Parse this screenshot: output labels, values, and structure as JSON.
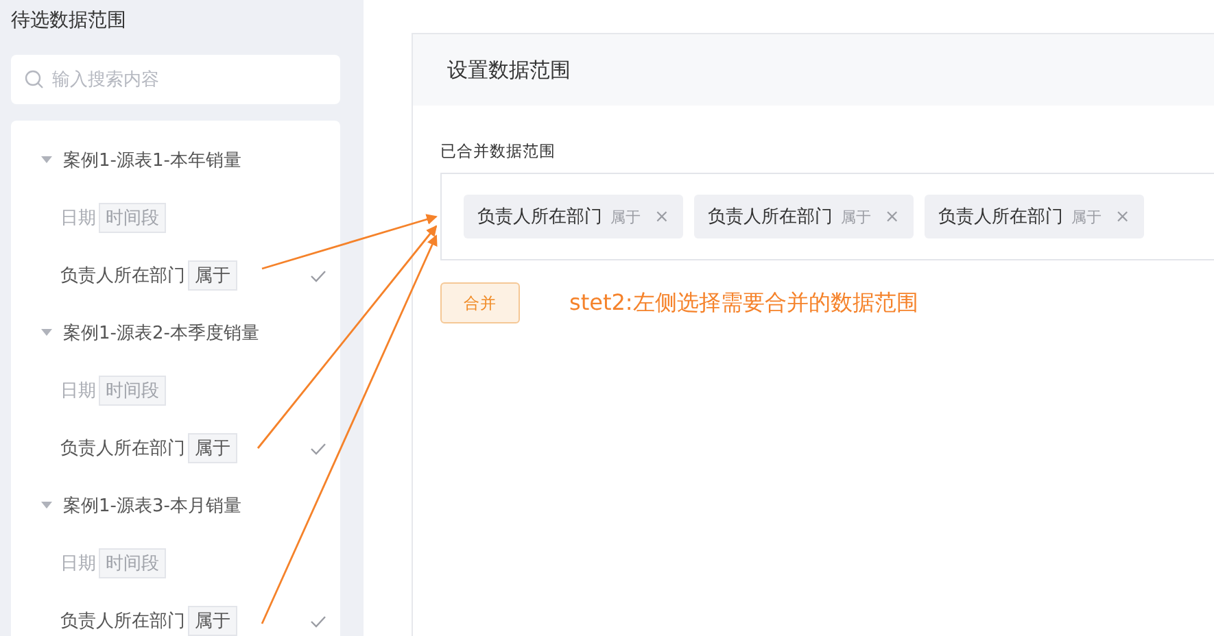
{
  "sidebar": {
    "title": "待选数据范围",
    "search": {
      "placeholder": "输入搜索内容"
    },
    "groups": [
      {
        "label": "案例1-源表1-本年销量",
        "expanded": true,
        "children": [
          {
            "label": "日期",
            "tag": "时间段",
            "disabled": true,
            "checked": false
          },
          {
            "label": "负责人所在部门",
            "tag": "属于",
            "disabled": false,
            "checked": true
          }
        ]
      },
      {
        "label": "案例1-源表2-本季度销量",
        "expanded": true,
        "children": [
          {
            "label": "日期",
            "tag": "时间段",
            "disabled": true,
            "checked": false
          },
          {
            "label": "负责人所在部门",
            "tag": "属于",
            "disabled": false,
            "checked": true
          }
        ]
      },
      {
        "label": "案例1-源表3-本月销量",
        "expanded": true,
        "children": [
          {
            "label": "日期",
            "tag": "时间段",
            "disabled": true,
            "checked": false
          },
          {
            "label": "负责人所在部门",
            "tag": "属于",
            "disabled": false,
            "checked": true
          }
        ]
      }
    ]
  },
  "dialog": {
    "title": "设置数据范围",
    "merged_label": "已合并数据范围",
    "tags": [
      {
        "label": "负责人所在部门",
        "operator": "属于",
        "remove": "×"
      },
      {
        "label": "负责人所在部门",
        "operator": "属于",
        "remove": "×"
      },
      {
        "label": "负责人所在部门",
        "operator": "属于",
        "remove": "×"
      }
    ],
    "merge_button": "合并"
  },
  "annotation": "stet2:左侧选择需要合并的数据范围"
}
